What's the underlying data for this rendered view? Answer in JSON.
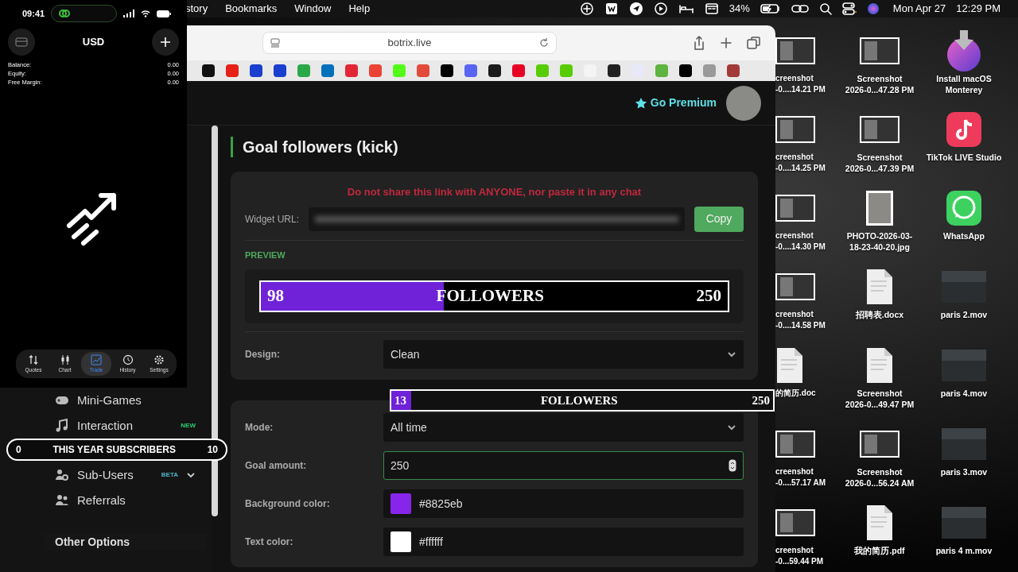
{
  "menu_bar": {
    "menus": [
      "story",
      "Bookmarks",
      "Window",
      "Help"
    ],
    "battery_percent": "34%",
    "date": "Mon Apr 27",
    "time": "12:29 PM"
  },
  "phone_app": {
    "status_time": "09:41",
    "currency": "USD",
    "account": [
      {
        "label": "Balance:",
        "value": "0.00"
      },
      {
        "label": "Equity:",
        "value": "0.00"
      },
      {
        "label": "Free Margin:",
        "value": "0.00"
      }
    ],
    "tabs": [
      {
        "label": "Quotes",
        "selected": false
      },
      {
        "label": "Chart",
        "selected": false
      },
      {
        "label": "Trade",
        "selected": true
      },
      {
        "label": "History",
        "selected": false
      },
      {
        "label": "Settings",
        "selected": false
      }
    ]
  },
  "browser": {
    "address": "botrix.live",
    "bookmarks": [
      {
        "color": "#111111"
      },
      {
        "color": "#e62117"
      },
      {
        "color": "#1a3fcf"
      },
      {
        "color": "#1a3fcf"
      },
      {
        "color": "#2aa84a"
      },
      {
        "color": "#0070ba"
      },
      {
        "color": "#e32636"
      },
      {
        "color": "#ea4335"
      },
      {
        "color": "#53fc18"
      },
      {
        "color": "#e24a3b"
      },
      {
        "color": "#000000"
      },
      {
        "color": "#5865f2"
      },
      {
        "color": "#1b1b1b"
      },
      {
        "color": "#e60023"
      },
      {
        "color": "#58cc02"
      },
      {
        "color": "#58cc02"
      },
      {
        "color": "#f4f4f4"
      },
      {
        "color": "#222222"
      },
      {
        "color": "#e8e8f8"
      },
      {
        "color": "#5fb341"
      },
      {
        "color": "#000000"
      },
      {
        "color": "#9a9a9a"
      },
      {
        "color": "#a33a3a"
      }
    ],
    "premium_link": "Go Premium",
    "sidebar": [
      {
        "kind": "item",
        "label": "Mini-Games"
      },
      {
        "kind": "item",
        "label": "Interaction",
        "badge": "NEW",
        "color": "#2ecc71"
      },
      {
        "kind": "item",
        "label": "Sub-Users",
        "badge": "BETA",
        "color": "#4fb3c9",
        "expanded": false
      },
      {
        "kind": "item",
        "label": "Referrals"
      },
      {
        "kind": "section",
        "label": "Other Options"
      }
    ],
    "page": {
      "title": "Goal followers (kick)",
      "warning": "Do not share this link with ANYONE, nor paste it in any chat",
      "url_label": "Widget URL:",
      "copy_button": "Copy",
      "preview_label": "PREVIEW",
      "preview": {
        "current": "98",
        "label": "FOLLOWERS",
        "target": "250",
        "level": 0.392
      },
      "design_fields": [
        {
          "kind": "select",
          "label": "Design:",
          "value": "Clean"
        }
      ],
      "settings_fields": [
        {
          "kind": "select",
          "label": "Mode:",
          "value": "All time"
        },
        {
          "kind": "number",
          "label": "Goal amount:",
          "value": "250",
          "focused": true
        },
        {
          "kind": "color",
          "label": "Background color:",
          "value": "#8825eb"
        },
        {
          "kind": "color",
          "label": "Text color:",
          "value": "#ffffff"
        }
      ]
    }
  },
  "overlays": [
    {
      "kind": "serif",
      "current": "13",
      "label": "FOLLOWERS",
      "target": "250",
      "level": 0.052
    },
    {
      "kind": "pill",
      "current": "0",
      "label": "THIS YEAR SUBSCRIBERS",
      "target": "10"
    }
  ],
  "desktop_columns": [
    [
      {
        "kind": "thumbnail",
        "lines": [
          "creenshot",
          "-0....14.21 PM"
        ]
      },
      {
        "kind": "thumbnail",
        "lines": [
          "creenshot",
          "-0....14.25 PM"
        ]
      },
      {
        "kind": "thumbnail",
        "lines": [
          "creenshot",
          "-0....14.30 PM"
        ]
      },
      {
        "kind": "thumbnail",
        "lines": [
          "creenshot",
          "-0....14.58 PM"
        ]
      },
      {
        "kind": "document",
        "lines": [
          "的简历.doc"
        ]
      },
      {
        "kind": "thumbnail",
        "lines": [
          "creenshot",
          "-0....57.17 AM"
        ]
      },
      {
        "kind": "thumbnail",
        "lines": [
          "creenshot",
          "-0...59.44 PM"
        ]
      }
    ],
    [
      {
        "kind": "thumbnail",
        "lines": [
          "Screenshot",
          "2026-0...47.28 PM"
        ]
      },
      {
        "kind": "thumbnail",
        "lines": [
          "Screenshot",
          "2026-0...47.39 PM"
        ]
      },
      {
        "kind": "photo",
        "lines": [
          "PHOTO-2026-03-",
          "18-23-40-20.jpg"
        ]
      },
      {
        "kind": "document",
        "lines": [
          "招聘表.docx"
        ]
      },
      {
        "kind": "document",
        "lines": [
          "Screenshot",
          "2026-0...49.47 PM"
        ]
      },
      {
        "kind": "thumbnail",
        "lines": [
          "Screenshot",
          "2026-0...56.24 AM"
        ]
      },
      {
        "kind": "document",
        "lines": [
          "我的简历.pdf"
        ]
      }
    ],
    [
      {
        "kind": "installer",
        "lines": [
          "Install macOS",
          "Monterey"
        ]
      },
      {
        "kind": "music-app",
        "lines": [
          "TikTok LIVE Studio"
        ]
      },
      {
        "kind": "chat-app",
        "lines": [
          "WhatsApp"
        ]
      },
      {
        "kind": "video",
        "lines": [
          "paris 2.mov"
        ]
      },
      {
        "kind": "video",
        "lines": [
          "paris 4.mov"
        ]
      },
      {
        "kind": "video",
        "lines": [
          "paris 3.mov"
        ]
      },
      {
        "kind": "video",
        "lines": [
          "paris 4 m.mov"
        ]
      }
    ]
  ]
}
